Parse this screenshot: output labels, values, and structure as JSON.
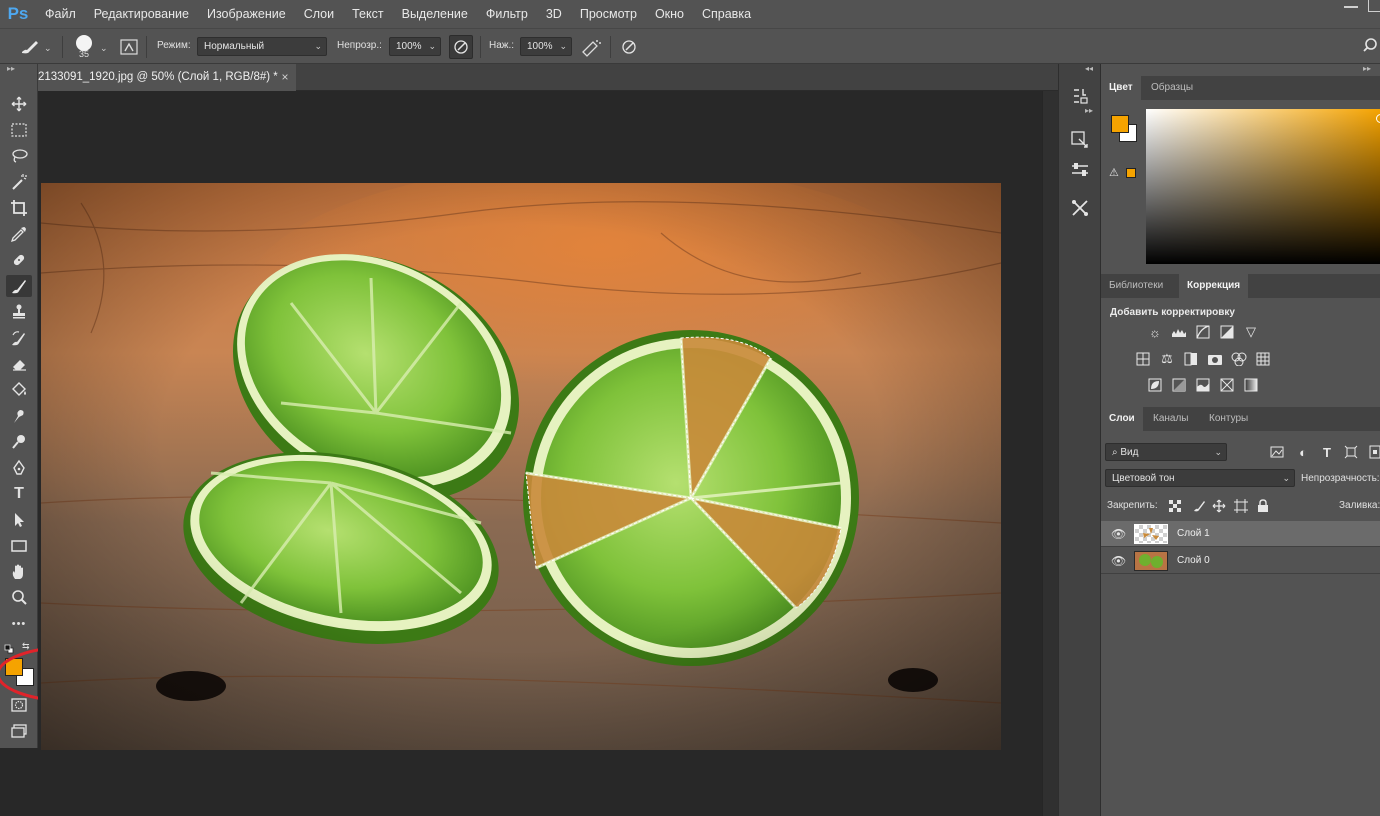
{
  "app": {
    "logo": "Ps"
  },
  "menu": [
    "Файл",
    "Редактирование",
    "Изображение",
    "Слои",
    "Текст",
    "Выделение",
    "Фильтр",
    "3D",
    "Просмотр",
    "Окно",
    "Справка"
  ],
  "options": {
    "brush_size": "35",
    "mode_label": "Режим:",
    "mode_value": "Нормальный",
    "opacity_label": "Непрозр.:",
    "opacity_value": "100%",
    "flow_label": "Наж.:",
    "flow_value": "100%"
  },
  "document": {
    "tab_title": "2133091_1920.jpg @ 50% (Слой 1, RGB/8#) *",
    "close_glyph": "×"
  },
  "tools": [
    "move-icon",
    "marquee-icon",
    "lasso-icon",
    "magic-wand-icon",
    "crop-icon",
    "eyedropper-icon",
    "healing-icon",
    "brush-icon",
    "stamp-icon",
    "history-brush-icon",
    "eraser-icon",
    "bucket-icon",
    "smudge-icon",
    "dodge-icon",
    "pen-icon",
    "type-icon",
    "path-select-icon",
    "rectangle-icon",
    "hand-icon",
    "zoom-icon",
    "more-icon"
  ],
  "tool_glyphs": {
    "type": "T",
    "more": "•••"
  },
  "colors": {
    "foreground": "#f5a300",
    "background": "#ffffff",
    "annotation": "#e0232a"
  },
  "color_panel": {
    "tabs": [
      "Цвет",
      "Образцы"
    ],
    "active_tab": "Цвет"
  },
  "adjust_panel": {
    "tabs": [
      "Библиотеки",
      "Коррекция"
    ],
    "active_tab": "Коррекция",
    "title": "Добавить корректировку"
  },
  "layers_panel": {
    "tabs": [
      "Слои",
      "Каналы",
      "Контуры"
    ],
    "active_tab": "Слои",
    "filter_label": "Вид",
    "blend_mode": "Цветовой тон",
    "opacity_label": "Непрозрачность:",
    "lock_label": "Закрепить:",
    "fill_label": "Заливка:",
    "layers": [
      {
        "name": "Слой 1",
        "selected": true
      },
      {
        "name": "Слой 0",
        "selected": false
      }
    ]
  }
}
